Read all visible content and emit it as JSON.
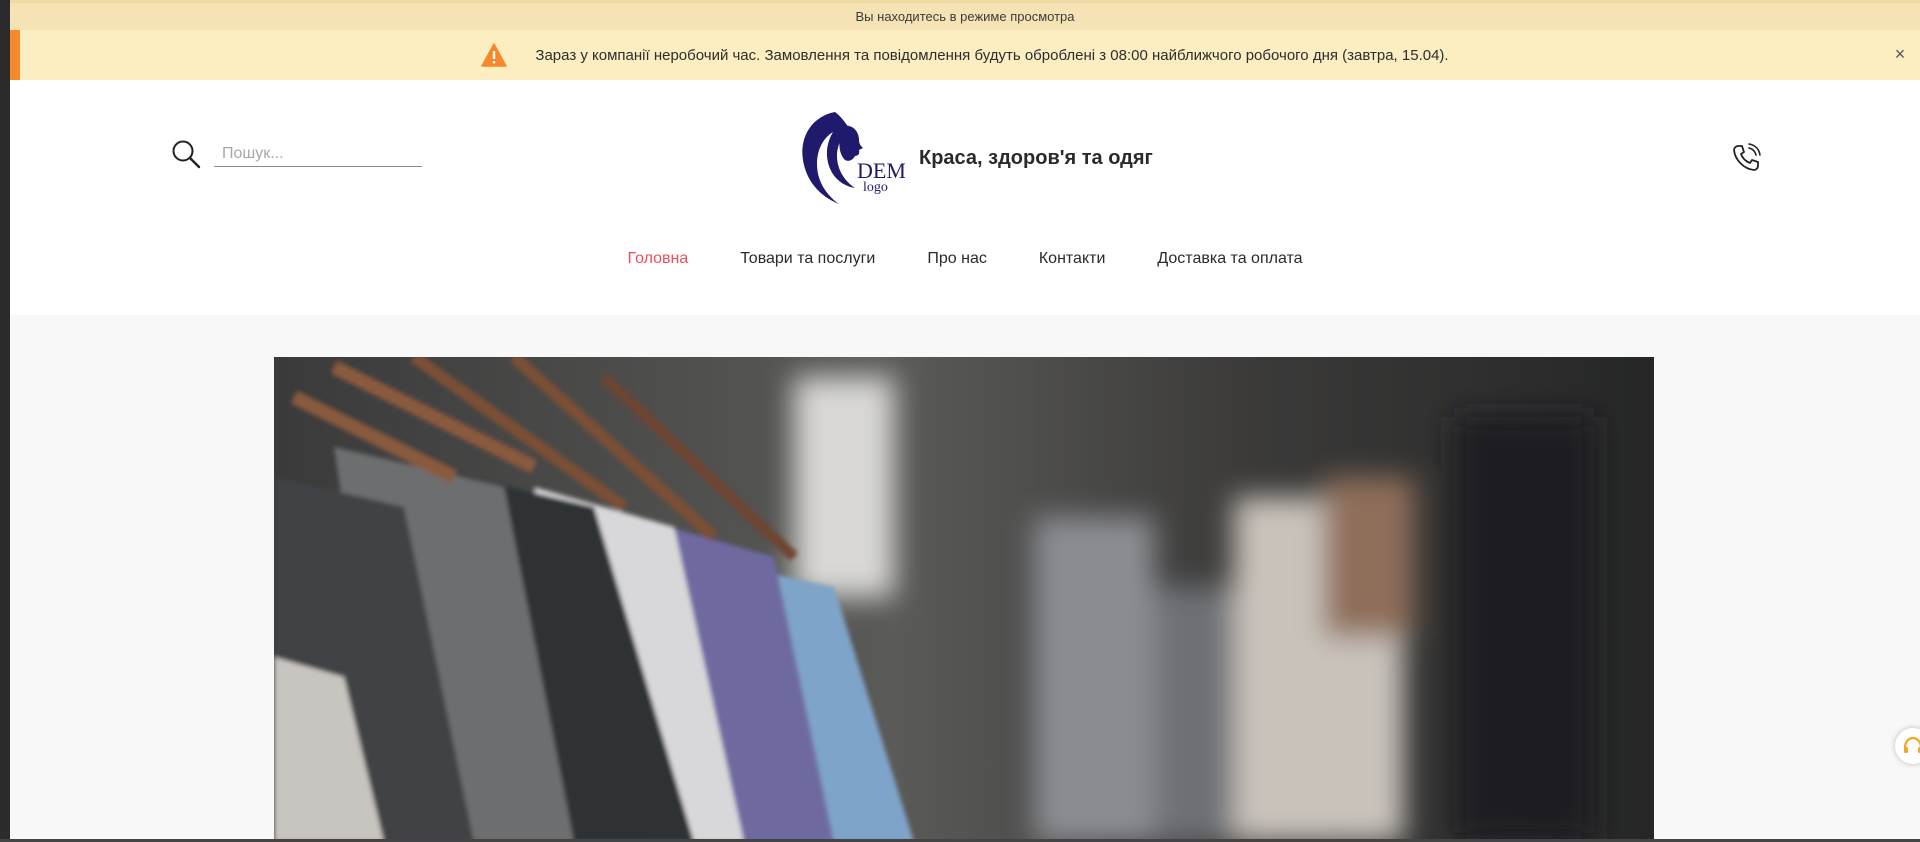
{
  "preview_bar": {
    "text": "Вы находитесь в режиме просмотра"
  },
  "notice": {
    "message": "Зараз у компанії неробочий час. Замовлення та повідомлення будуть оброблені з 08:00 найближчого робочого дня (завтра, 15.04).",
    "close_label": "×",
    "warning_icon": "warning-triangle-icon",
    "accent_color": "#f5892b",
    "background_color": "#fdeec2"
  },
  "header": {
    "search": {
      "placeholder": "Пошук...",
      "value": "",
      "icon": "search-icon"
    },
    "logo": {
      "line1": "DEMO",
      "line2": "logo",
      "color": "#1f1a6b"
    },
    "site_name": "Краса, здоров'я та одяг",
    "phone_icon": "phone-icon"
  },
  "nav": {
    "items": [
      {
        "label": "Головна",
        "active": true
      },
      {
        "label": "Товари та послуги",
        "active": false
      },
      {
        "label": "Про нас",
        "active": false
      },
      {
        "label": "Контакти",
        "active": false
      },
      {
        "label": "Доставка та оплата",
        "active": false
      }
    ],
    "active_color": "#e8515c"
  },
  "hero": {
    "image": "clothes-rack-photo"
  },
  "support_widget": {
    "icon": "headset-icon",
    "color": "#f5a623"
  }
}
